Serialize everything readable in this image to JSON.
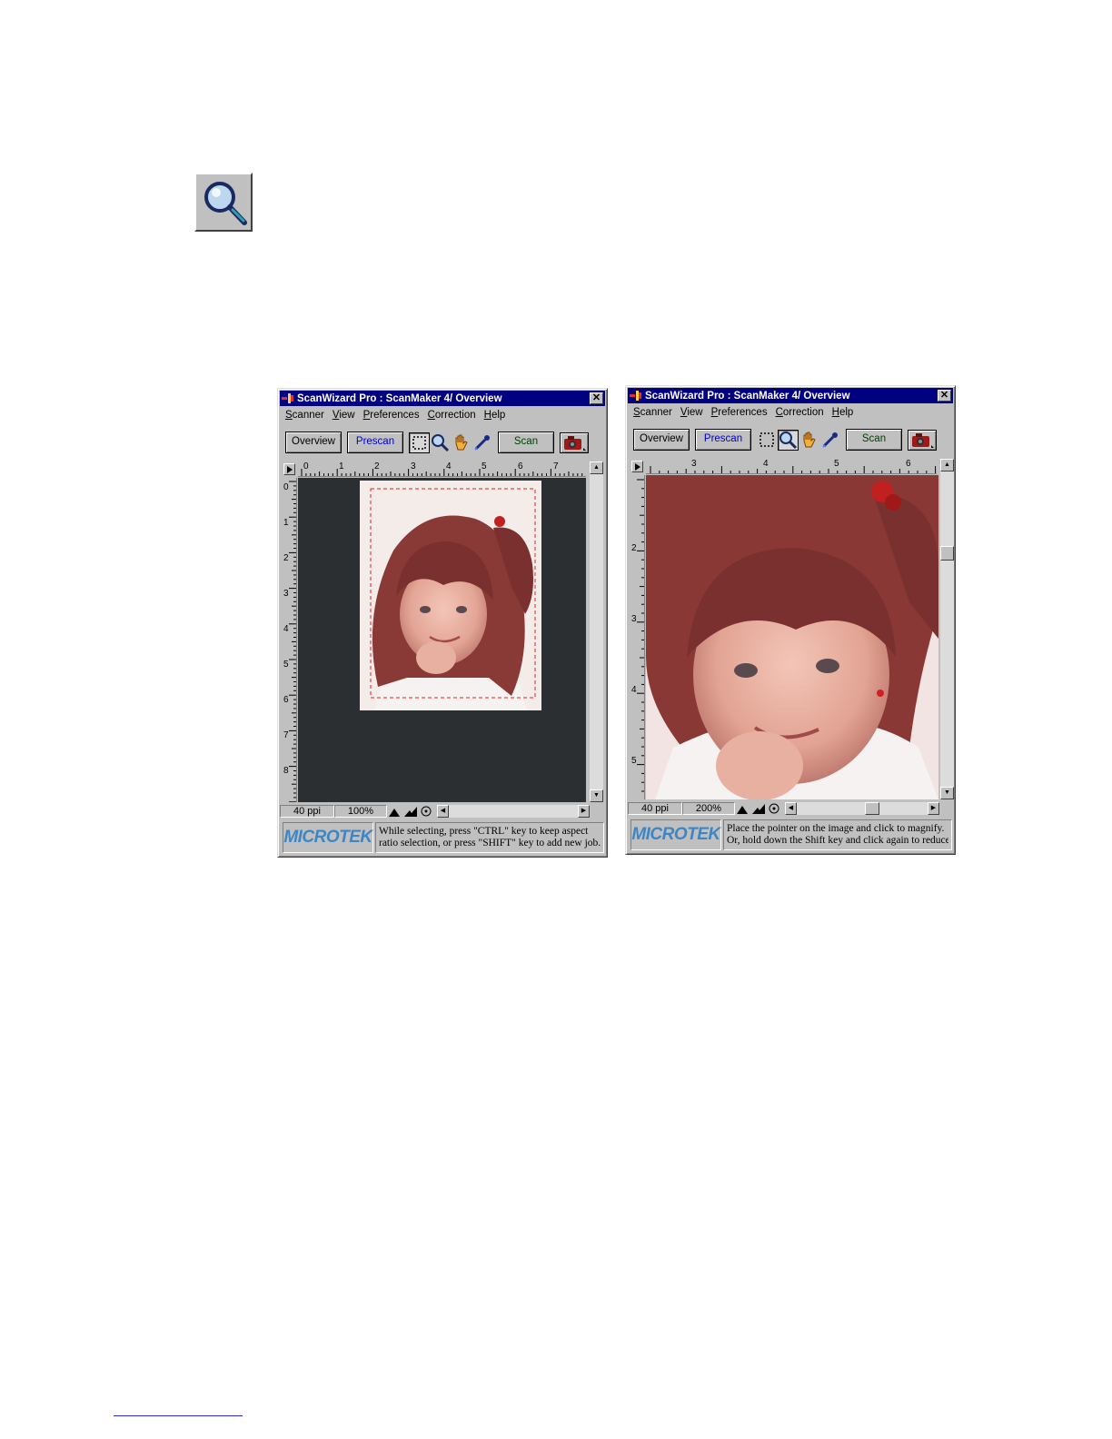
{
  "zoom_tool": {
    "icon": "magnifier-icon"
  },
  "windows": [
    {
      "title": "ScanWizard Pro : ScanMaker 4/ Overview",
      "menu": [
        "Scanner",
        "View",
        "Preferences",
        "Correction",
        "Help"
      ],
      "buttons": {
        "overview": "Overview",
        "prescan": "Prescan",
        "scan": "Scan"
      },
      "ruler_top": [
        "0",
        "1",
        "2",
        "3",
        "4",
        "5",
        "6",
        "7"
      ],
      "ruler_left": [
        "0",
        "1",
        "2",
        "3",
        "4",
        "5",
        "6",
        "7",
        "8"
      ],
      "status": {
        "resolution": "40 ppi",
        "zoom": "100%"
      },
      "logo": "MICROTEK",
      "hint": [
        "While selecting, press \"CTRL\" key to keep aspect",
        "ratio selection, or press \"SHIFT\" key to add new job."
      ]
    },
    {
      "title": "ScanWizard Pro : ScanMaker 4/ Overview",
      "menu": [
        "Scanner",
        "View",
        "Preferences",
        "Correction",
        "Help"
      ],
      "buttons": {
        "overview": "Overview",
        "prescan": "Prescan",
        "scan": "Scan"
      },
      "ruler_top": [
        "3",
        "4",
        "5",
        "6"
      ],
      "ruler_left": [
        "2",
        "3",
        "4",
        "5"
      ],
      "status": {
        "resolution": "40 ppi",
        "zoom": "200%"
      },
      "logo": "MICROTEK",
      "hint": [
        "Place the pointer on the image and click to magnify.",
        "Or, hold down the Shift key and click again to reduce"
      ]
    }
  ],
  "colors": {
    "titlebar": "#000080",
    "face": "#c0c0c0",
    "scan_bg": "#2b2f31",
    "logo": "#3d86c6"
  }
}
